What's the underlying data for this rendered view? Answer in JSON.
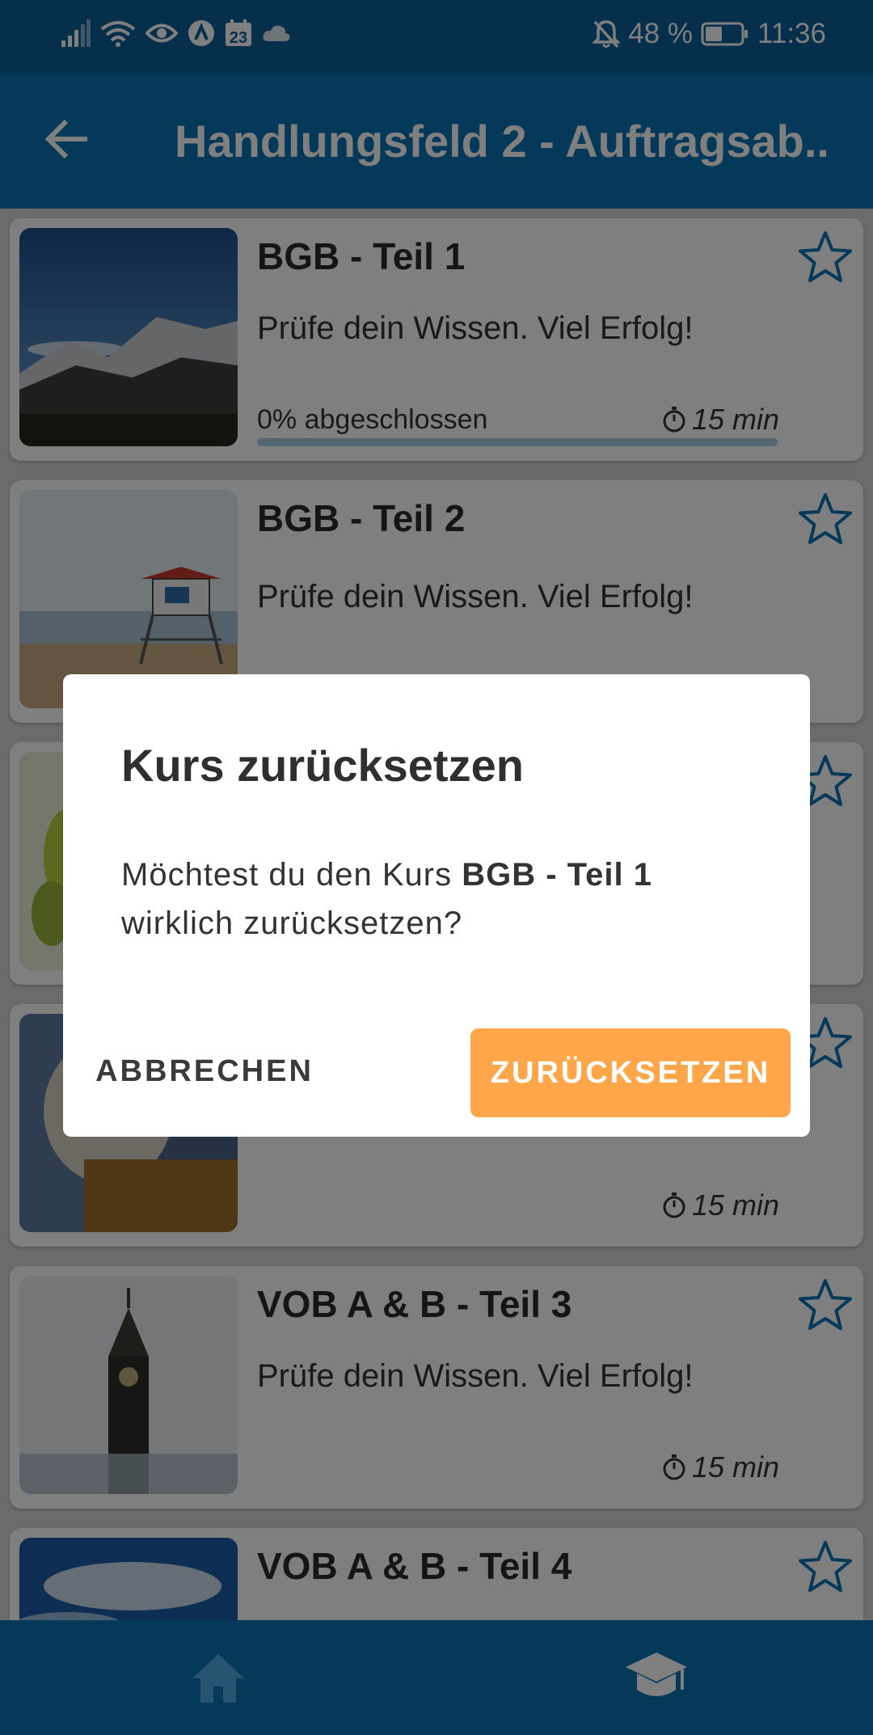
{
  "status_bar": {
    "battery_percent": "48 %",
    "time": "11:36",
    "calendar_day": "23",
    "icons": [
      "signal-icon",
      "wifi-icon",
      "eye-icon",
      "app-a-icon",
      "calendar-icon",
      "cloud-icon",
      "bell-off-icon",
      "battery-icon"
    ],
    "battery_level": 0.48
  },
  "app_bar": {
    "title": "Handlungsfeld 2 - Auftragsab..",
    "back_icon": "arrow-left-icon"
  },
  "courses": [
    {
      "title": "BGB - Teil 1",
      "description": "Prüfe dein Wissen. Viel Erfolg!",
      "progress_text": "0% abgeschlossen",
      "progress": 0.0,
      "duration": "15 min",
      "thumb": "mountain"
    },
    {
      "title": "BGB - Teil 2",
      "description": "Prüfe dein Wissen. Viel Erfolg!",
      "progress_text": "",
      "duration": "",
      "thumb": "lifeguard-tower"
    },
    {
      "title": "",
      "description": "",
      "progress_text": "",
      "duration": "",
      "thumb": "green-plant"
    },
    {
      "title": "",
      "description": "",
      "progress_text": "",
      "duration": "15 min",
      "thumb": "person-sweater"
    },
    {
      "title": "VOB A & B - Teil 3",
      "description": "Prüfe dein Wissen. Viel Erfolg!",
      "progress_text": "",
      "duration": "15 min",
      "thumb": "big-ben"
    },
    {
      "title": "VOB A & B - Teil 4",
      "description": "",
      "progress_text": "",
      "duration": "",
      "thumb": "ocean-wave"
    }
  ],
  "bottom_nav": {
    "items": [
      "home-icon",
      "graduation-cap-icon"
    ]
  },
  "dialog": {
    "title": "Kurs zurücksetzen",
    "message_prefix": "Möchtest du den Kurs ",
    "message_course": "BGB - Teil 1",
    "message_suffix": " wirklich zurücksetzen?",
    "cancel_label": "ABBRECHEN",
    "confirm_label": "ZURÜCKSETZEN"
  },
  "colors": {
    "status_bar": "#0a5f96",
    "primary": "#0a72b4",
    "accent": "#ffa64a",
    "star": "#0a72b4"
  }
}
